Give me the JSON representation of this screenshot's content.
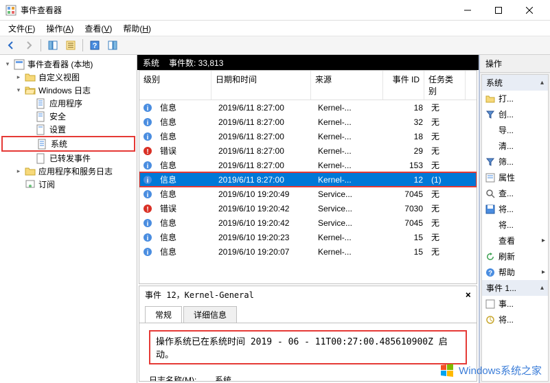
{
  "window": {
    "title": "事件查看器"
  },
  "menu": {
    "file": "文件(F)",
    "action": "操作(A)",
    "view": "查看(V)",
    "help": "帮助(H)"
  },
  "tree": {
    "root": "事件查看器 (本地)",
    "custom_views": "自定义视图",
    "windows_logs": "Windows 日志",
    "app": "应用程序",
    "security": "安全",
    "setup": "设置",
    "system": "系统",
    "forwarded": "已转发事件",
    "app_svc_logs": "应用程序和服务日志",
    "subscriptions": "订阅"
  },
  "header": {
    "log_name": "系统",
    "count_label": "事件数: 33,813"
  },
  "columns": {
    "level": "级别",
    "datetime": "日期和时间",
    "source": "来源",
    "eventid": "事件 ID",
    "category": "任务类别"
  },
  "rows": [
    {
      "level": "信息",
      "icon": "info",
      "datetime": "2019/6/11 8:27:00",
      "source": "Kernel-...",
      "eventid": "18",
      "category": "无"
    },
    {
      "level": "信息",
      "icon": "info",
      "datetime": "2019/6/11 8:27:00",
      "source": "Kernel-...",
      "eventid": "32",
      "category": "无"
    },
    {
      "level": "信息",
      "icon": "info",
      "datetime": "2019/6/11 8:27:00",
      "source": "Kernel-...",
      "eventid": "18",
      "category": "无"
    },
    {
      "level": "错误",
      "icon": "error",
      "datetime": "2019/6/11 8:27:00",
      "source": "Kernel-...",
      "eventid": "29",
      "category": "无"
    },
    {
      "level": "信息",
      "icon": "info",
      "datetime": "2019/6/11 8:27:00",
      "source": "Kernel-...",
      "eventid": "153",
      "category": "无"
    },
    {
      "level": "信息",
      "icon": "info",
      "datetime": "2019/6/11 8:27:00",
      "source": "Kernel-...",
      "eventid": "12",
      "category": "(1)",
      "selected": true
    },
    {
      "level": "信息",
      "icon": "info",
      "datetime": "2019/6/10 19:20:49",
      "source": "Service...",
      "eventid": "7045",
      "category": "无"
    },
    {
      "level": "错误",
      "icon": "error",
      "datetime": "2019/6/10 19:20:42",
      "source": "Service...",
      "eventid": "7030",
      "category": "无"
    },
    {
      "level": "信息",
      "icon": "info",
      "datetime": "2019/6/10 19:20:42",
      "source": "Service...",
      "eventid": "7045",
      "category": "无"
    },
    {
      "level": "信息",
      "icon": "info",
      "datetime": "2019/6/10 19:20:23",
      "source": "Kernel-...",
      "eventid": "15",
      "category": "无"
    },
    {
      "level": "信息",
      "icon": "info",
      "datetime": "2019/6/10 19:20:07",
      "source": "Kernel-...",
      "eventid": "15",
      "category": "无"
    }
  ],
  "detail": {
    "title": "事件 12，Kernel-General",
    "tab_general": "常规",
    "tab_details": "详细信息",
    "message": "操作系统已在系统时间 ‎2019‎ - ‎06‎ - ‎11T00:27:00.485610900Z 启动。",
    "logname_label": "日志名称(M):",
    "logname_value": "系统"
  },
  "actions": {
    "title": "操作",
    "group_system": "系统",
    "open": "打...",
    "create": "创...",
    "import": "导...",
    "clear": "清...",
    "filter": "筛...",
    "properties": "属性",
    "find": "查...",
    "save": "将...",
    "attach": "将...",
    "view": "查看",
    "refresh": "刷新",
    "help": "帮助",
    "group_event": "事件 1...",
    "event_prop": "事...",
    "event_attach": "将..."
  },
  "watermark": "Windows系统之家"
}
